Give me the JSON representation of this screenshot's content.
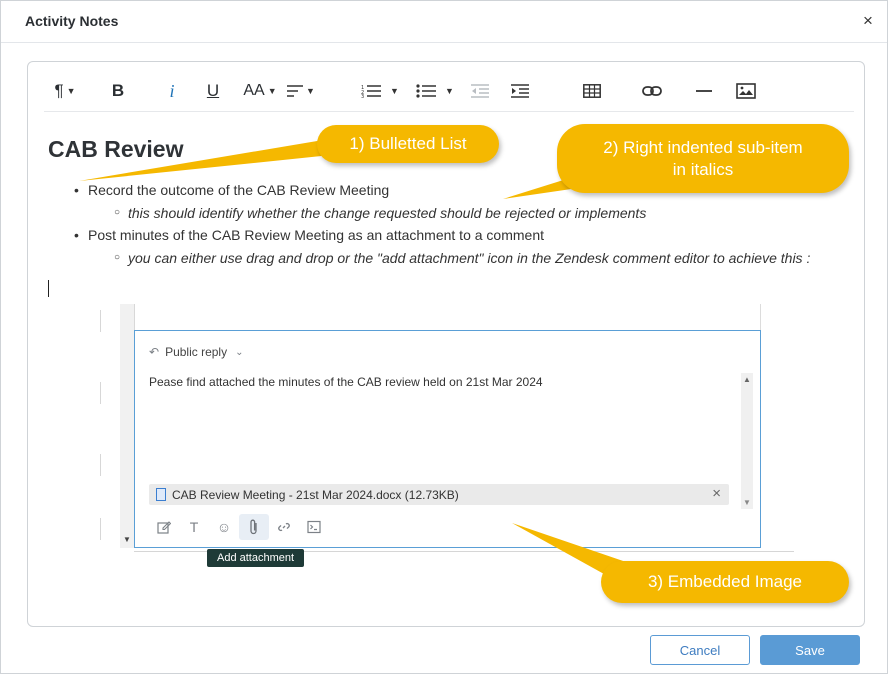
{
  "dialog": {
    "title": "Activity Notes",
    "close_glyph": "×"
  },
  "toolbar": {
    "items": [
      "paragraph-format",
      "bold",
      "italic",
      "underline",
      "font-size",
      "align",
      "ordered-list",
      "bullet-list",
      "outdent",
      "indent",
      "table",
      "link",
      "horizontal-rule",
      "image"
    ],
    "bold_glyph": "B",
    "italic_glyph": "i",
    "underline_glyph": "U",
    "font_size_glyph": "AA",
    "paragraph_glyph": "¶"
  },
  "document": {
    "heading": "CAB Review",
    "bullets": [
      {
        "text": "Record the outcome of the CAB Review Meeting",
        "sub": "this should identify whether the change requested should be rejected or implements"
      },
      {
        "text": "Post minutes of the CAB Review Meeting as an attachment to a comment",
        "sub": "you can either use drag and drop or the \"add attachment\" icon in the Zendesk comment editor to achieve this :"
      }
    ]
  },
  "embedded": {
    "reply_mode": "Public reply",
    "message": "Pease find attached the minutes of the CAB review held on 21st Mar 2024",
    "attachment": "CAB Review Meeting - 21st Mar 2024.docx (12.73KB)",
    "tooltip": "Add attachment",
    "tools": [
      "edit-icon",
      "text-icon",
      "emoji-icon",
      "paperclip-icon",
      "link-icon",
      "terminal-icon"
    ]
  },
  "callouts": {
    "one": "1) Bulletted List",
    "two_line1": "2) Right indented sub-item",
    "two_line2": "in italics",
    "three": "3) Embedded Image"
  },
  "colors": {
    "callout": "#f5b800",
    "accent_blue": "#5a9bd5",
    "tooltip_bg": "#1e3a37"
  },
  "footer": {
    "cancel": "Cancel",
    "save": "Save"
  }
}
